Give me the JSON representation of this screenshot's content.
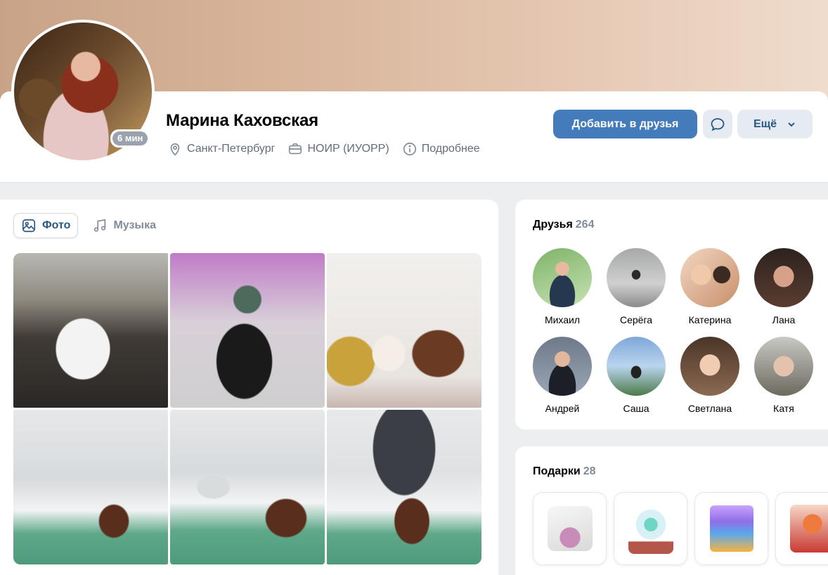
{
  "profile": {
    "name": "Марина Каховская",
    "online": "6 мин",
    "city": "Санкт-Петербург",
    "work": "НОИР (ИУОРР)",
    "details": "Подробнее",
    "add_friend": "Добавить в друзья",
    "more": "Ещё"
  },
  "media": {
    "tabs": [
      {
        "label": "Фото",
        "icon": "photo-icon",
        "active": true
      },
      {
        "label": "Музыка",
        "icon": "music-icon",
        "active": false
      }
    ],
    "photos": 6
  },
  "friends": {
    "title": "Друзья",
    "count": "264",
    "items": [
      {
        "name": "Михаил"
      },
      {
        "name": "Серёга"
      },
      {
        "name": "Катерина"
      },
      {
        "name": "Лана"
      },
      {
        "name": "Андрей"
      },
      {
        "name": "Саша"
      },
      {
        "name": "Светлана"
      },
      {
        "name": "Катя"
      }
    ]
  },
  "gifts": {
    "title": "Подарки",
    "count": "28"
  },
  "colors": {
    "accent": "#447bba",
    "link": "#2a5885",
    "secondary": "#818c99",
    "background": "#edeef0"
  }
}
